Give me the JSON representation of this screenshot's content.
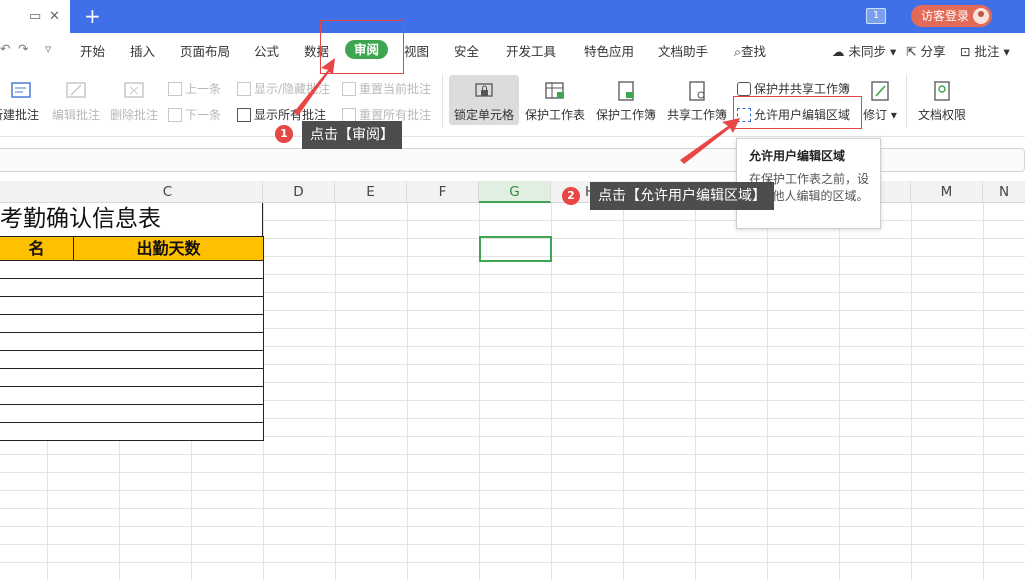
{
  "titlebar": {
    "badge": "1",
    "login_label": "访客登录",
    "new_tab": "+"
  },
  "menu": {
    "items": [
      "开始",
      "插入",
      "页面布局",
      "公式",
      "数据",
      "审阅",
      "视图",
      "安全",
      "开发工具",
      "特色应用",
      "文档助手",
      "查找"
    ],
    "active": "审阅",
    "right": {
      "sync": "未同步",
      "share": "分享",
      "comment": "批注"
    }
  },
  "ribbon": {
    "new_comment": "新建批注",
    "edit_comment": "编辑批注",
    "delete_comment": "删除批注",
    "prev": "上一条",
    "next": "下一条",
    "show_hide_comment": "显示/隐藏批注",
    "show_all_comments": "显示所有批注",
    "reset_current": "重置当前批注",
    "reset_all": "重置所有批注",
    "lock_cell": "锁定单元格",
    "protect_sheet": "保护工作表",
    "protect_workbook": "保护工作簿",
    "share_workbook": "共享工作簿",
    "protect_share_workbook": "保护并共享工作簿",
    "allow_edit_range": "允许用户编辑区域",
    "revise": "修订",
    "doc_permission": "文档权限"
  },
  "columns": [
    "C",
    "D",
    "E",
    "F",
    "G",
    "H",
    "M",
    "N"
  ],
  "sheet": {
    "title": "考勤确认信息表",
    "header_name": "名",
    "header_days": "出勤天数"
  },
  "annotations": {
    "step1_num": "1",
    "step1_text": "点击【审阅】",
    "step2_num": "2",
    "step2_text": "点击【允许用户编辑区域】",
    "color": "#e84545"
  },
  "tooltip": {
    "title": "允许用户编辑区域",
    "body": "在保护工作表之前，设置...他人编辑的区域。"
  }
}
